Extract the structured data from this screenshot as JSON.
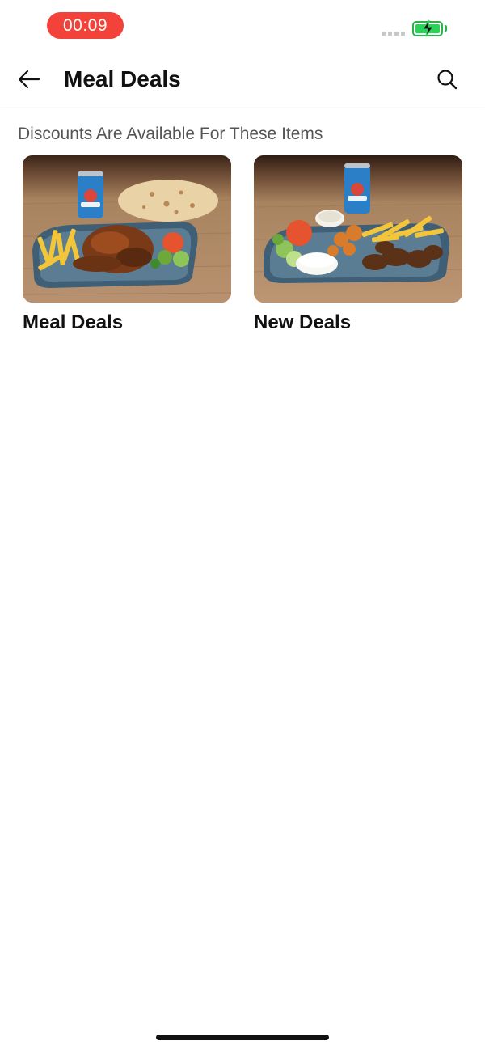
{
  "status_bar": {
    "time": "00:09",
    "battery_level_fraction": 1.0,
    "battery_charging": true,
    "battery_color": "#2bd158",
    "time_pill_color": "#f2423a"
  },
  "header": {
    "title": "Meal Deals",
    "back_icon": "arrow-left-icon",
    "search_icon": "search-icon"
  },
  "main": {
    "subtitle": "Discounts Are Available For These Items",
    "categories": [
      {
        "label": "Meal Deals",
        "image_icon": "chicken-platter-image"
      },
      {
        "label": "New Deals",
        "image_icon": "kebab-platter-image"
      }
    ]
  }
}
